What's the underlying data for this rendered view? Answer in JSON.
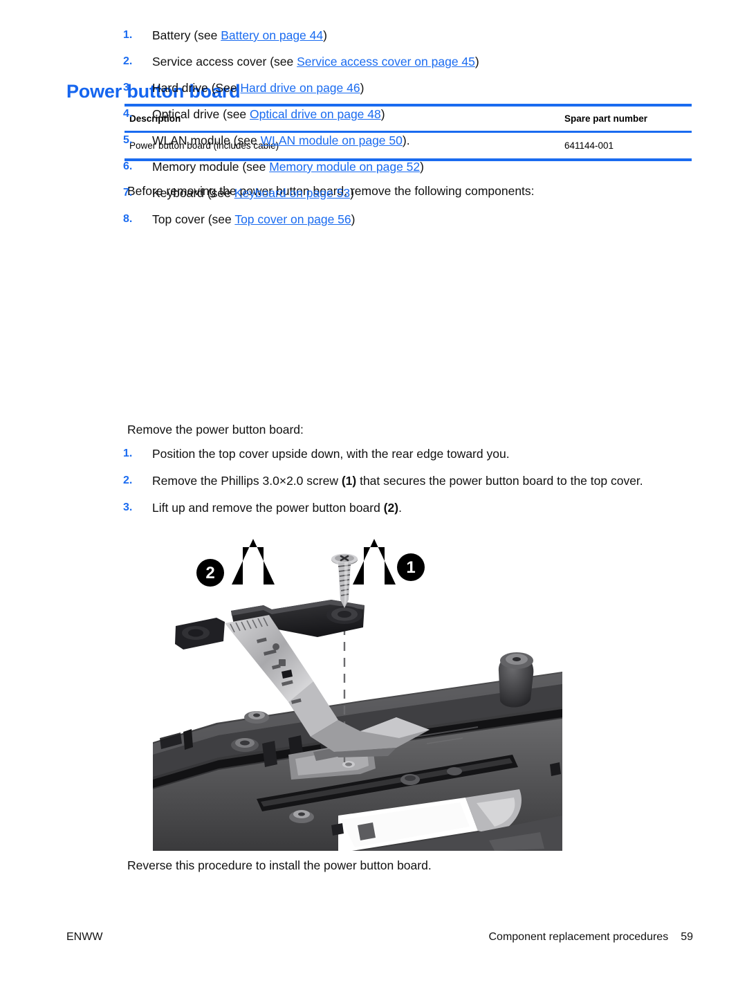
{
  "heading": "Power button board",
  "parts_table": {
    "columns": [
      "Description",
      "Spare part number"
    ],
    "rows": [
      {
        "description": "Power button board (includes cable)",
        "spare_part_number": "641144-001"
      }
    ]
  },
  "intro": "Before removing the power button board, remove the following components:",
  "prereq_list": [
    {
      "num": "1.",
      "pre": "Battery (see ",
      "link": "Battery on page 44",
      "post": ")"
    },
    {
      "num": "2.",
      "pre": "Service access cover (see ",
      "link": "Service access cover on page 45",
      "post": ")"
    },
    {
      "num": "3.",
      "pre": "Hard drive (See ",
      "link": "Hard drive on page 46",
      "post": ")"
    },
    {
      "num": "4.",
      "pre": "Optical drive (see ",
      "link": "Optical drive on page 48",
      "post": ")"
    },
    {
      "num": "5.",
      "pre": "WLAN module (see ",
      "link": "WLAN module on page 50",
      "post": ")."
    },
    {
      "num": "6.",
      "pre": "Memory module (see ",
      "link": "Memory module on page 52",
      "post": ")"
    },
    {
      "num": "7.",
      "pre": "Keyboard (see ",
      "link": "Keyboard on page 53",
      "post": ")"
    },
    {
      "num": "8.",
      "pre": "Top cover (see ",
      "link": "Top cover on page 56",
      "post": ")"
    }
  ],
  "procedure_intro": "Remove the power button board:",
  "procedure_list": [
    {
      "num": "1.",
      "p1": "Position the top cover upside down, with the rear edge toward you.",
      "b1": "",
      "p2": ""
    },
    {
      "num": "2.",
      "p1": "Remove the Phillips 3.0×2.0 screw ",
      "b1": "(1)",
      "p2": " that secures the power button board to the top cover."
    },
    {
      "num": "3.",
      "p1": "Lift up and remove the power button board ",
      "b1": "(2)",
      "p2": "."
    }
  ],
  "closing": "Reverse this procedure to install the power button board.",
  "figure": {
    "alt": "Exploded view photograph of laptop top cover with power button board and Phillips screw",
    "callouts": [
      {
        "id": "2",
        "label": "2"
      },
      {
        "id": "1",
        "label": "1"
      }
    ]
  },
  "footer": {
    "left": "ENWW",
    "section": "Component replacement procedures",
    "page": "59"
  },
  "colors": {
    "heading_blue": "#1565ef",
    "rule_blue": "#1a6bf0",
    "link_blue": "#1a6bf0",
    "text_black": "#101010"
  }
}
